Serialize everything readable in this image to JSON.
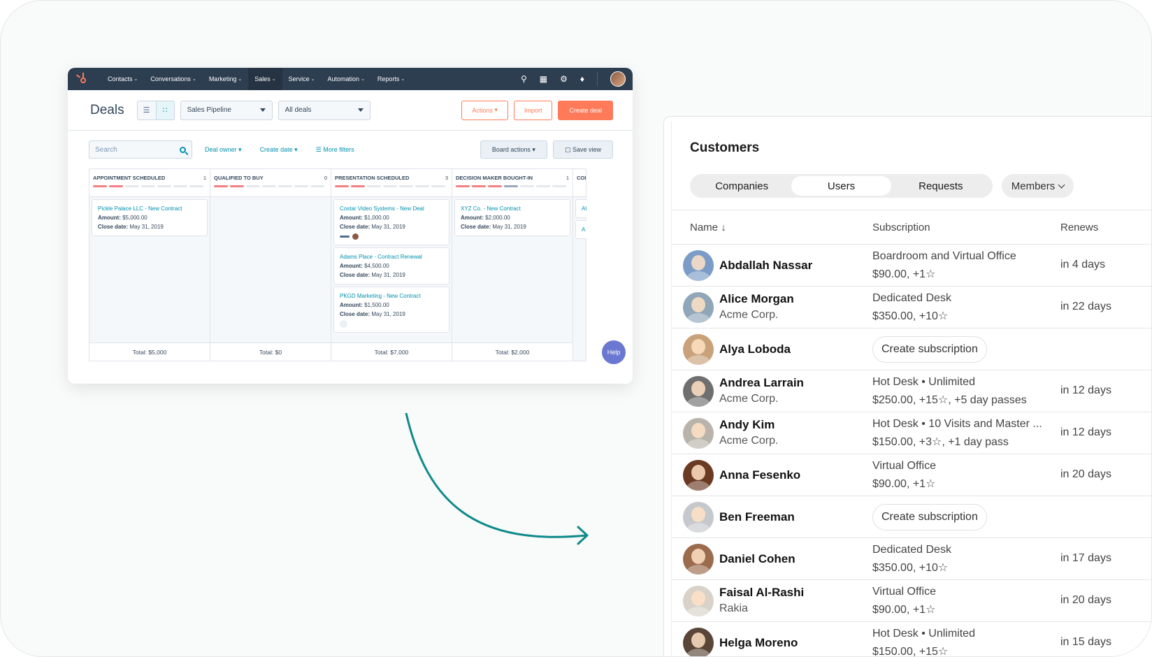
{
  "hubspot": {
    "nav": [
      "Contacts",
      "Conversations",
      "Marketing",
      "Sales",
      "Service",
      "Automation",
      "Reports"
    ],
    "active_nav": "Sales",
    "title": "Deals",
    "pipeline": "Sales Pipeline",
    "view_select": "All deals",
    "actions_label": "Actions",
    "import_label": "Import",
    "create_label": "Create deal",
    "search_placeholder": "Search",
    "filters": [
      "Deal owner",
      "Create date",
      "More filters"
    ],
    "board_actions": "Board actions",
    "save_view": "Save view",
    "help": "Help",
    "columns": [
      {
        "name": "APPOINTMENT SCHEDULED",
        "count": "1",
        "bars": "rrrrrrr",
        "total": "Total: $5,000",
        "cards": [
          {
            "title": "Pickle Palace LLC - New Contract",
            "amount": "$5,000.00",
            "close": "May 31, 2019",
            "chips": ""
          }
        ]
      },
      {
        "name": "QUALIFIED TO BUY",
        "count": "0",
        "bars": "rrrrrrr",
        "total": "Total: $0",
        "cards": []
      },
      {
        "name": "PRESENTATION SCHEDULED",
        "count": "3",
        "bars": "rrrrrrr",
        "total": "Total: $7,000",
        "cards": [
          {
            "title": "Costar Video Systems - New Deal",
            "amount": "$1,000.00",
            "close": "May 31, 2019",
            "chips": "avatar"
          },
          {
            "title": "Adams Place - Contract Renewal",
            "amount": "$4,500.00",
            "close": "May 31, 2019",
            "chips": ""
          },
          {
            "title": "PKGD Marketing - New Contract",
            "amount": "$1,500.00",
            "close": "May 31, 2019",
            "chips": "ghost"
          }
        ]
      },
      {
        "name": "DECISION MAKER BOUGHT-IN",
        "count": "1",
        "bars": "rrrrrrr",
        "total": "Total: $2,000",
        "cards": [
          {
            "title": "XYZ Co. - New Contract",
            "amount": "$2,000.00",
            "close": "May 31, 2019",
            "chips": ""
          }
        ]
      },
      {
        "name": "COI",
        "count": "",
        "bars": "r",
        "total": "",
        "cards": [
          {
            "title": "Al",
            "amount": "",
            "close": "",
            "chips": ""
          },
          {
            "title": "A",
            "amount": "",
            "close": "",
            "chips": ""
          }
        ]
      }
    ],
    "labels": {
      "amount": "Amount:",
      "close": "Close date:"
    }
  },
  "customers": {
    "title": "Customers",
    "tabs": [
      "Companies",
      "Users",
      "Requests"
    ],
    "active_tab": "Users",
    "members": "Members",
    "headers": {
      "name": "Name",
      "subscription": "Subscription",
      "renews": "Renews"
    },
    "rows": [
      {
        "name": "Abdallah Nassar",
        "company": "",
        "sub1": "Boardroom and Virtual Office",
        "sub2": "$90.00, +1☆",
        "renews": "in 4 days",
        "color": "#7a9cc6"
      },
      {
        "name": "Alice Morgan",
        "company": "Acme Corp.",
        "sub1": "Dedicated Desk",
        "sub2": "$350.00, +10☆",
        "renews": "in 22 days",
        "color": "#8fa7b8"
      },
      {
        "name": "Alya Loboda",
        "company": "",
        "sub1": "",
        "sub2": "",
        "create": "Create subscription",
        "renews": "",
        "color": "#c9a27a"
      },
      {
        "name": "Andrea Larrain",
        "company": "Acme Corp.",
        "sub1": "Hot Desk • Unlimited",
        "sub2": "$250.00, +15☆, +5 day passes",
        "renews": "in 12 days",
        "color": "#6f6f6f"
      },
      {
        "name": "Andy Kim",
        "company": "Acme Corp.",
        "sub1": "Hot Desk • 10 Visits and Master ...",
        "sub2": "$150.00, +3☆, +1 day pass",
        "renews": "in 12 days",
        "color": "#b9b4ab"
      },
      {
        "name": "Anna Fesenko",
        "company": "",
        "sub1": "Virtual Office",
        "sub2": "$90.00, +1☆",
        "renews": "in 20 days",
        "color": "#6b3a22"
      },
      {
        "name": "Ben Freeman",
        "company": "",
        "sub1": "",
        "sub2": "",
        "create": "Create subscription",
        "renews": "",
        "color": "#c5c8cc"
      },
      {
        "name": "Daniel Cohen",
        "company": "",
        "sub1": "Dedicated Desk",
        "sub2": "$350.00, +10☆",
        "renews": "in 17 days",
        "color": "#9b6b4e"
      },
      {
        "name": "Faisal Al-Rashi",
        "company": "Rakia",
        "sub1": "Virtual Office",
        "sub2": "$90.00, +1☆",
        "renews": "in 20 days",
        "color": "#d8d2c8"
      },
      {
        "name": "Helga Moreno",
        "company": "",
        "sub1": "Hot Desk • Unlimited",
        "sub2": "$150.00, +15☆",
        "renews": "in 15 days",
        "color": "#5a4638"
      }
    ]
  },
  "colors": {
    "hubspot_orange": "#ff7a59",
    "hubspot_nav": "#2d3e50",
    "hubspot_link": "#0091ae",
    "arrow": "#0f8a8a"
  },
  "icons": [
    "sprocket-logo-icon",
    "search-icon",
    "marketplace-icon",
    "gear-icon",
    "bell-icon",
    "list-view-icon",
    "board-view-icon",
    "save-icon",
    "sort-down-icon",
    "chevron-down-icon",
    "curved-arrow-icon"
  ]
}
